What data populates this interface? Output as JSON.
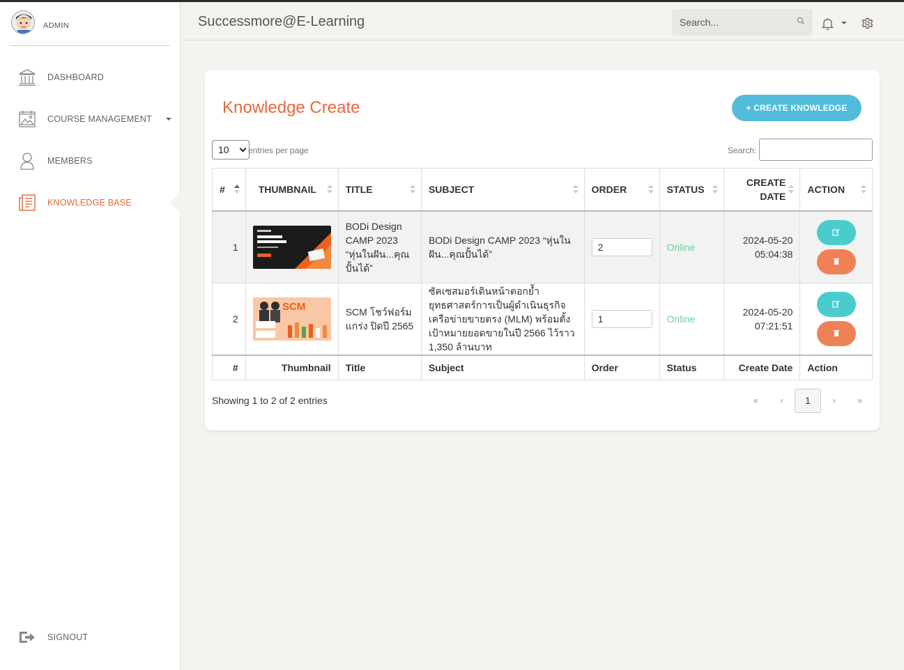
{
  "brand": {
    "user": "ADMIN"
  },
  "sidebar": {
    "items": [
      {
        "label": "DASHBOARD",
        "icon": "bank-icon"
      },
      {
        "label": "COURSE MANAGEMENT",
        "icon": "gallery-icon"
      },
      {
        "label": "MEMBERS",
        "icon": "user-icon"
      },
      {
        "label": "KNOWLEDGE BASE",
        "icon": "paper-icon",
        "active": true
      },
      {
        "label": "SIGNOUT",
        "icon": "logout-icon"
      }
    ]
  },
  "navbar": {
    "title": "Successmore@E-Learning",
    "search_placeholder": "Search..."
  },
  "card": {
    "title": "Knowledge Create",
    "create_label": "+ CREATE KNOWLEDGE",
    "page_length": "10",
    "page_length_label": "entries per page",
    "search_label": "Search:"
  },
  "table": {
    "headers": [
      "#",
      "THUMBNAIL",
      "TITLE",
      "SUBJECT",
      "ORDER",
      "STATUS",
      "CREATE DATE",
      "ACTION"
    ],
    "footers": [
      "#",
      "Thumbnail",
      "Title",
      "Subject",
      "Order",
      "Status",
      "Create Date",
      "Action"
    ],
    "rows": [
      {
        "num": "1",
        "title": "BODi Design CAMP 2023 “หุ่นในฝัน...คุณปั้นได้”",
        "subject": "BODi Design CAMP 2023 “หุ่นในฝัน...คุณปั้นได้”",
        "order": "2",
        "status": "Online",
        "date": "2024-05-20",
        "time": "05:04:38"
      },
      {
        "num": "2",
        "title": "SCM โชว์ฟอร์มแกร่ง ปิดปี 2565",
        "subject": "ซัคเซสมอร์เดินหน้าตอกย้ำยุทธศาสตร์การเป็นผู้ดำเนินธุรกิจเครือข่ายขายตรง (MLM) พร้อมตั้งเป้าหมายยอดขายในปี 2566 ไว้ราว 1,350 ล้านบาท",
        "order": "1",
        "status": "Online",
        "date": "2024-05-20",
        "time": "07:21:51"
      }
    ]
  },
  "pagination": {
    "info": "Showing 1 to 2 of 2 entries",
    "first": "«",
    "prev": "‹",
    "current": "1",
    "next": "›",
    "last": "»"
  },
  "colors": {
    "accent": "#e8663d",
    "info": "#51bcda",
    "success": "#6bd098",
    "edit": "#4acccd",
    "danger": "#ef8157"
  }
}
